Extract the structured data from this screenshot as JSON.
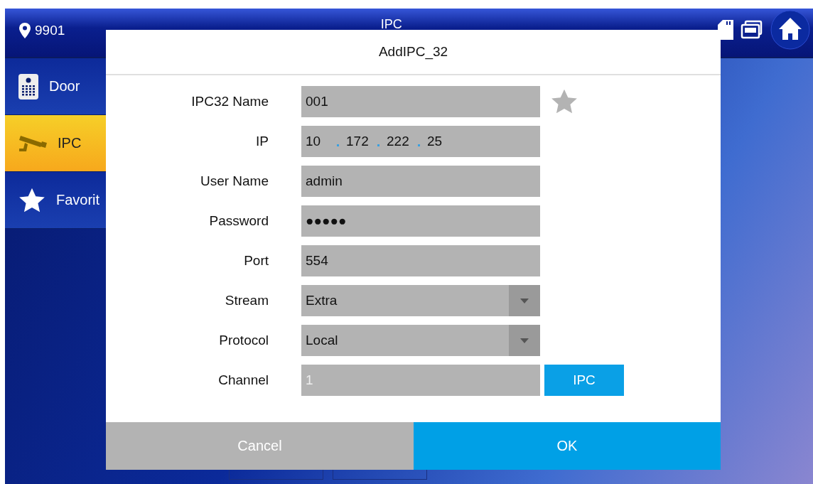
{
  "status_bar": {
    "location": "9901",
    "title": "IPC"
  },
  "sidebar": {
    "items": [
      {
        "label": "Door",
        "kind": "door",
        "selected": false
      },
      {
        "label": "IPC",
        "kind": "camera",
        "selected": true
      },
      {
        "label": "Favorit",
        "kind": "star",
        "selected": false
      }
    ]
  },
  "dialog": {
    "title": "AddIPC_32",
    "fields": [
      {
        "label": "IPC32 Name",
        "kind": "text",
        "value": "001",
        "favorite": false
      },
      {
        "label": "IP",
        "kind": "ip",
        "octets": [
          "10",
          "172",
          "222",
          "25"
        ]
      },
      {
        "label": "User Name",
        "kind": "text",
        "value": "admin"
      },
      {
        "label": "Password",
        "kind": "password",
        "value": "●●●●●"
      },
      {
        "label": "Port",
        "kind": "text",
        "value": "554"
      },
      {
        "label": "Stream",
        "kind": "select",
        "value": "Extra"
      },
      {
        "label": "Protocol",
        "kind": "select",
        "value": "Local"
      },
      {
        "label": "Channel",
        "kind": "channel",
        "value": "1",
        "button": "IPC",
        "disabled": true
      }
    ],
    "buttons": [
      "Cancel",
      "OK"
    ]
  }
}
